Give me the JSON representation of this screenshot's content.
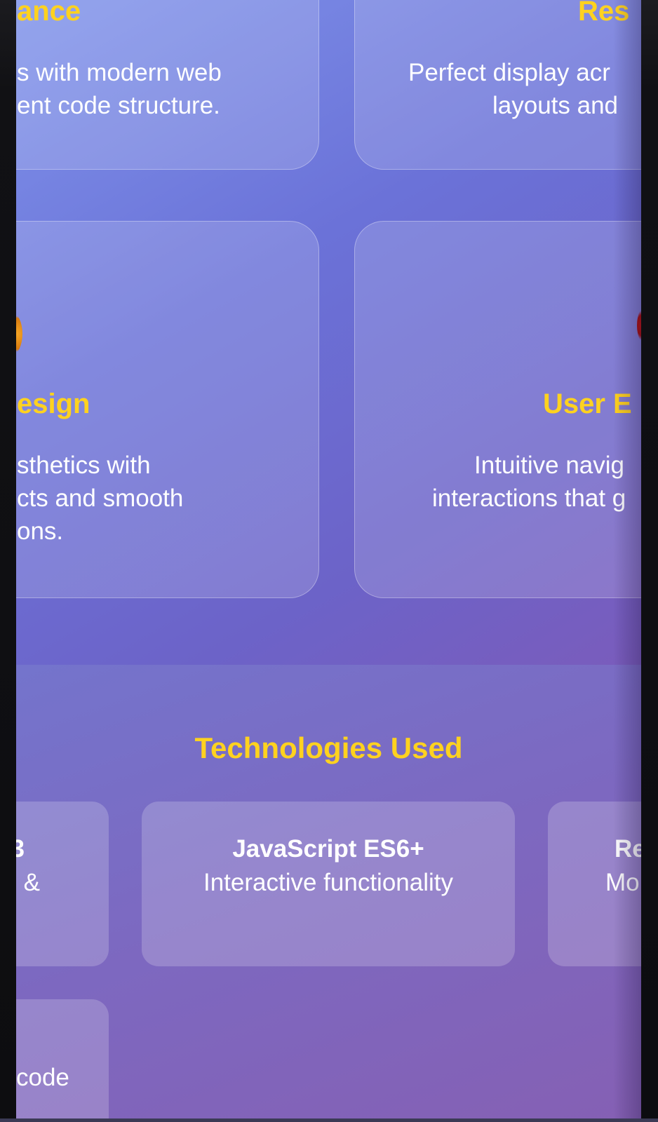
{
  "features": {
    "cards": [
      {
        "title": "ance",
        "desc_line1": "s with modern web",
        "desc_line2": "ent code structure."
      },
      {
        "title": "Res",
        "desc_line1": "Perfect display acr",
        "desc_line2": "layouts and"
      },
      {
        "title": "esign",
        "desc_line1": "sthetics with",
        "desc_line2": "cts and smooth",
        "desc_line3": "ons."
      },
      {
        "title": "User E",
        "desc_line1": "Intuitive navig",
        "desc_line2": "interactions that g"
      }
    ]
  },
  "technologies": {
    "heading": "Technologies Used",
    "cards": [
      {
        "name": "3",
        "desc": "&"
      },
      {
        "name": "JavaScript ES6+",
        "desc": "Interactive functionality"
      },
      {
        "name": "Re",
        "desc": "Mo"
      },
      {
        "name": "",
        "desc": "code"
      }
    ]
  },
  "colors": {
    "accent_yellow": "#ffd21f",
    "text_white": "#ffffff",
    "gradient_start": "#7f93ea",
    "gradient_end": "#8560b4"
  }
}
